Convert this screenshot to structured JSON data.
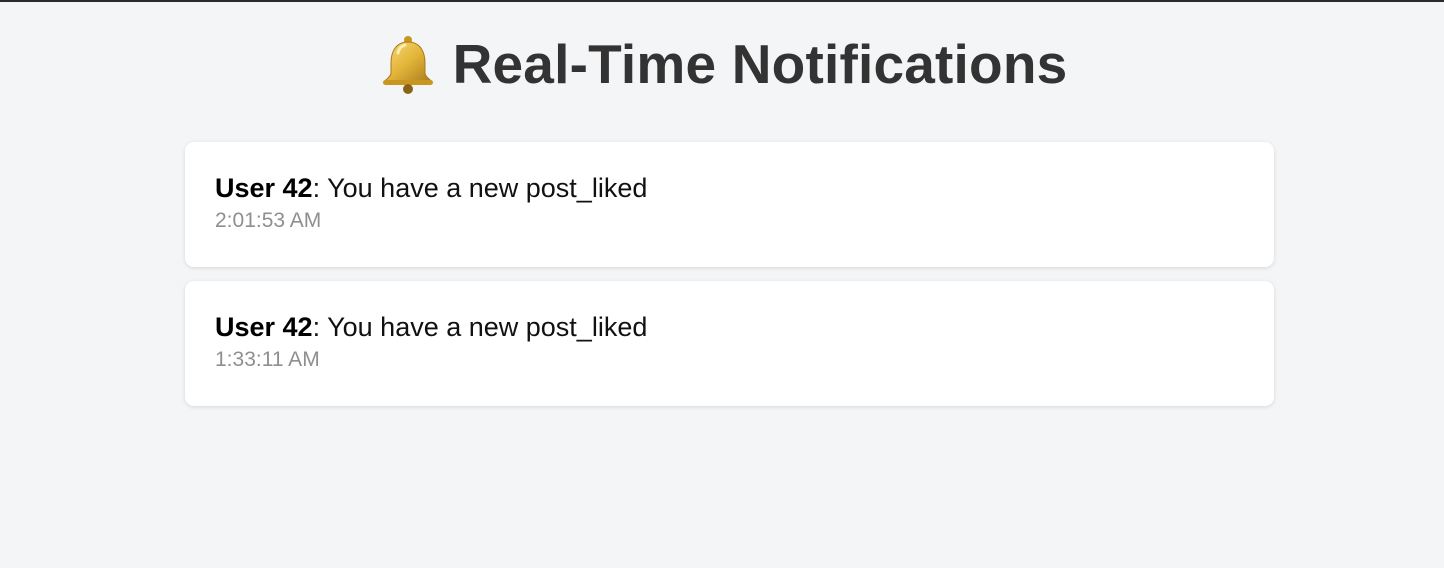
{
  "header": {
    "icon": "bell-icon",
    "title": "Real-Time Notifications"
  },
  "notifications": [
    {
      "user": "User 42",
      "separator": ":",
      "message": " You have a new post_liked",
      "time": "2:01:53 AM"
    },
    {
      "user": "User 42",
      "separator": ":",
      "message": " You have a new post_liked",
      "time": "1:33:11 AM"
    }
  ],
  "colors": {
    "background": "#f4f5f7",
    "card": "#ffffff",
    "title": "#333333",
    "timestamp": "#8f8f8f",
    "bell": "#e3b53a"
  }
}
